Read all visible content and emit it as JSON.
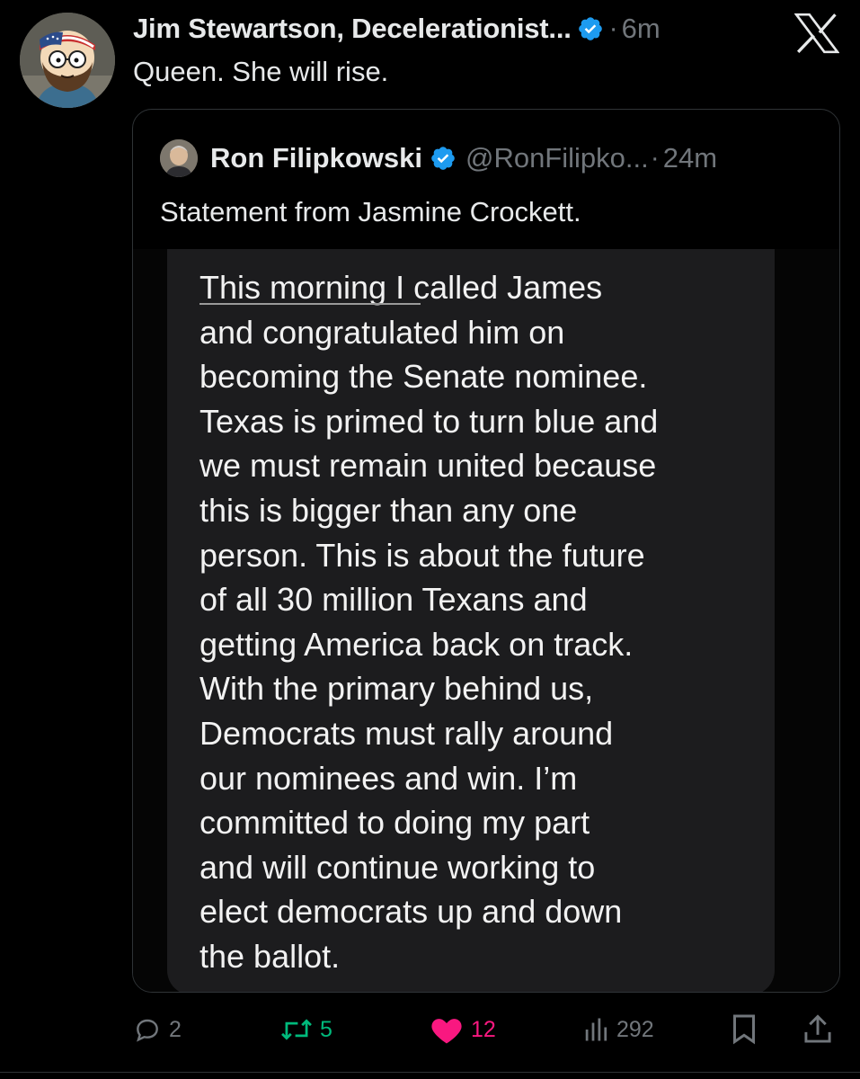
{
  "post": {
    "author_name": "Jim Stewartson, Decelerationist...",
    "separator": "·",
    "time": "6m",
    "text": "Queen. She will rise.",
    "avatar_icon": "cartoon-avatar-icon"
  },
  "quoted": {
    "author_name": "Ron Filipkowski",
    "handle": "@RonFilipko...",
    "separator": "·",
    "time": "24m",
    "text": "Statement from Jasmine Crockett.",
    "statement_lines": [
      "This morning I called James",
      "and congratulated him on",
      "becoming the Senate nominee.",
      "Texas is primed to turn blue and",
      "we must remain united because",
      "this is bigger than any one",
      "person. This is about the future",
      "of all 30 million Texans and",
      "getting America back on track.",
      "With the primary behind us,",
      "Democrats must rally around",
      "our nominees and win. I’m",
      "committed to doing my part",
      "and will continue working to",
      "elect democrats up and down",
      "the ballot."
    ]
  },
  "actions": {
    "replies": "2",
    "reposts": "5",
    "likes": "12",
    "views": "292"
  },
  "colors": {
    "background": "#000000",
    "text": "#e7e9ea",
    "muted": "#71767b",
    "verified_blue": "#1d9bf0",
    "repost_green": "#00ba7c",
    "like_pink": "#f91880",
    "border": "#2f3336",
    "statement_bg": "#1c1c1e"
  }
}
